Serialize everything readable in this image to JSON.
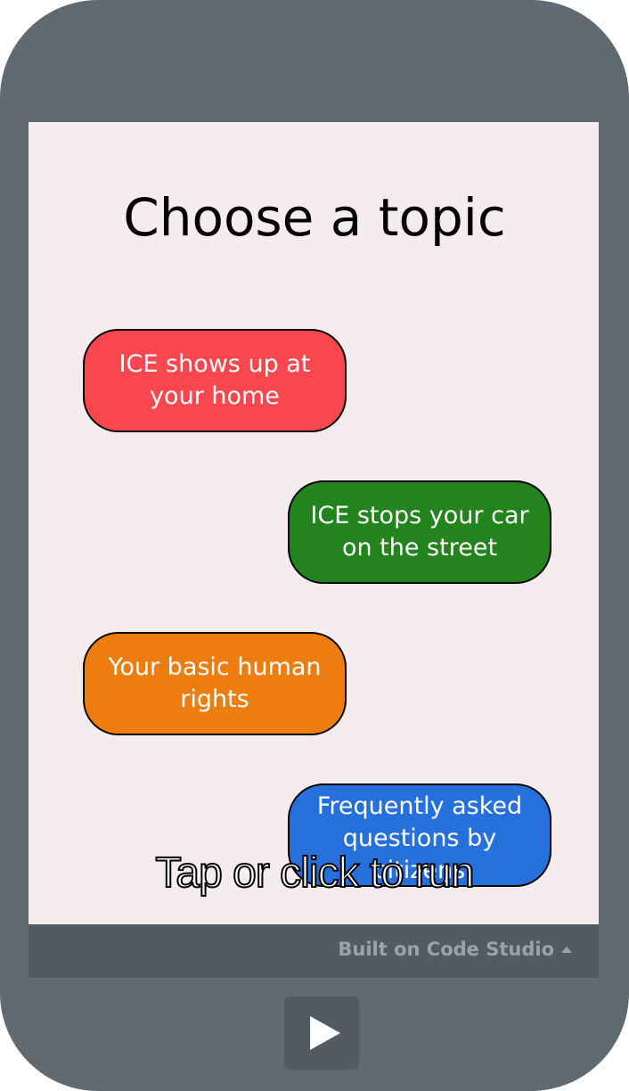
{
  "app": {
    "title": "Choose a topic"
  },
  "topics": [
    {
      "label": "ICE shows up at your home",
      "color": "#f8474f"
    },
    {
      "label": "ICE stops your car on the street",
      "color": "#23831d"
    },
    {
      "label": "Your basic human rights",
      "color": "#ee7d10"
    },
    {
      "label": "Frequently asked questions by citizens",
      "color": "#2670dc"
    }
  ],
  "overlay": {
    "run_prompt": "Tap or click to run"
  },
  "footer": {
    "built_on_label": "Built on Code Studio",
    "caret_icon": "caret-up-icon"
  },
  "controls": {
    "run_icon": "play-icon"
  },
  "colors": {
    "device_frame": "#5f6a72",
    "screen_background": "#f5eced",
    "footer_bar": "#525b62"
  }
}
